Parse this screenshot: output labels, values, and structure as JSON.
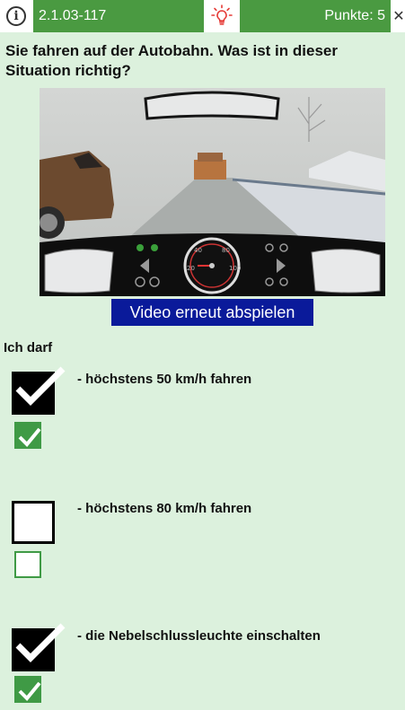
{
  "header": {
    "info_icon": "info-icon",
    "question_id": "2.1.03-117",
    "hint_icon": "lightbulb-icon",
    "score_label": "Punkte: 5",
    "close_icon": "close-icon"
  },
  "question": {
    "text": "Sie fahren auf der Autobahn. Was ist in dieser Situation richtig?"
  },
  "media": {
    "replay_label": "Video erneut abspielen"
  },
  "answers_section": {
    "label": "Ich darf"
  },
  "answers": [
    {
      "text": "- höchstens 50 km/h fahren",
      "selected": true,
      "correct": true
    },
    {
      "text": "- höchstens 80 km/h fahren",
      "selected": false,
      "correct": false
    },
    {
      "text": "- die Nebelschlussleuchte einschalten",
      "selected": true,
      "correct": true
    }
  ],
  "colors": {
    "header_green": "#4a9a41",
    "background": "#dcf1dd",
    "replay_button": "#0a1a9a",
    "correct_green": "#3f9a45",
    "hint_icon": "#e53935"
  }
}
